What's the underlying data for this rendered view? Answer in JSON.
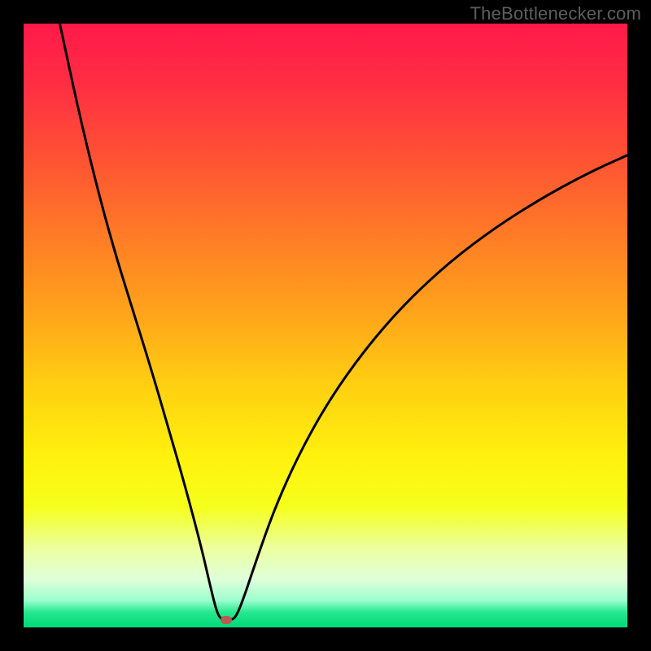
{
  "watermark": "TheBottlenecker.com",
  "colors": {
    "frame": "#000000",
    "marker": "#b65c52",
    "curve": "#000000",
    "gradient_stops": [
      {
        "offset": 0.0,
        "color": "#ff1a49"
      },
      {
        "offset": 0.1,
        "color": "#ff2e43"
      },
      {
        "offset": 0.22,
        "color": "#ff5134"
      },
      {
        "offset": 0.35,
        "color": "#ff7b26"
      },
      {
        "offset": 0.48,
        "color": "#ffa41b"
      },
      {
        "offset": 0.6,
        "color": "#ffd011"
      },
      {
        "offset": 0.72,
        "color": "#fff20d"
      },
      {
        "offset": 0.8,
        "color": "#f6ff1c"
      },
      {
        "offset": 0.87,
        "color": "#ecffa0"
      },
      {
        "offset": 0.92,
        "color": "#e0ffda"
      },
      {
        "offset": 0.955,
        "color": "#9dffce"
      },
      {
        "offset": 0.975,
        "color": "#25e88f"
      },
      {
        "offset": 1.0,
        "color": "#00d977"
      }
    ]
  },
  "chart_data": {
    "type": "line",
    "title": "",
    "xlabel": "",
    "ylabel": "",
    "xlim": [
      0,
      100
    ],
    "ylim": [
      0,
      100
    ],
    "marker": {
      "x": 33.5,
      "y": 1.2
    },
    "series": [
      {
        "name": "bottleneck-curve",
        "points": [
          {
            "x": 6.0,
            "y": 100.0
          },
          {
            "x": 9.0,
            "y": 86.0
          },
          {
            "x": 12.0,
            "y": 73.5
          },
          {
            "x": 15.0,
            "y": 62.5
          },
          {
            "x": 18.0,
            "y": 52.8
          },
          {
            "x": 21.0,
            "y": 43.2
          },
          {
            "x": 24.0,
            "y": 33.0
          },
          {
            "x": 27.0,
            "y": 22.5
          },
          {
            "x": 29.5,
            "y": 13.0
          },
          {
            "x": 31.0,
            "y": 6.5
          },
          {
            "x": 32.0,
            "y": 2.5
          },
          {
            "x": 32.8,
            "y": 1.2
          },
          {
            "x": 34.5,
            "y": 1.2
          },
          {
            "x": 35.3,
            "y": 2.0
          },
          {
            "x": 36.5,
            "y": 5.0
          },
          {
            "x": 38.5,
            "y": 11.0
          },
          {
            "x": 41.5,
            "y": 19.5
          },
          {
            "x": 45.5,
            "y": 28.5
          },
          {
            "x": 50.5,
            "y": 37.5
          },
          {
            "x": 56.5,
            "y": 46.0
          },
          {
            "x": 63.0,
            "y": 53.5
          },
          {
            "x": 70.5,
            "y": 60.5
          },
          {
            "x": 78.5,
            "y": 66.5
          },
          {
            "x": 86.5,
            "y": 71.5
          },
          {
            "x": 94.0,
            "y": 75.5
          },
          {
            "x": 100.0,
            "y": 78.2
          }
        ]
      }
    ]
  }
}
